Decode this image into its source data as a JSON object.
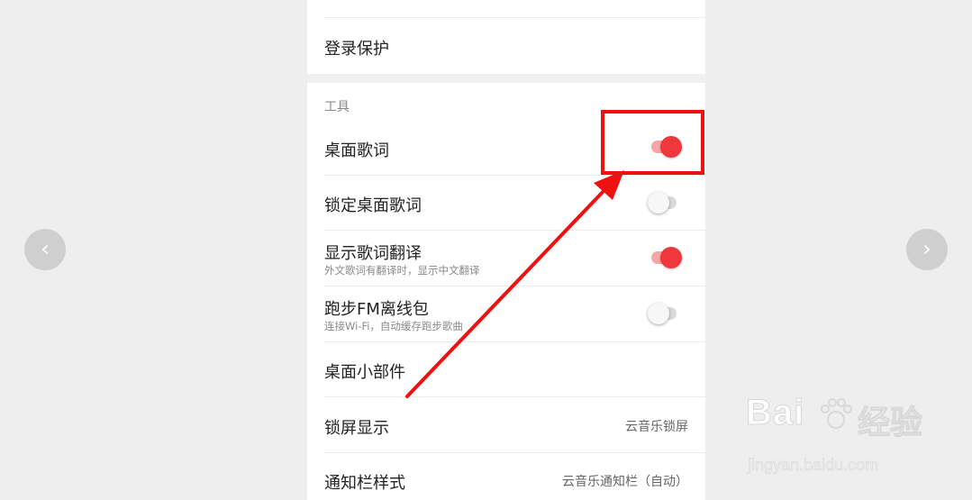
{
  "rows": {
    "login_protect": {
      "title": "登录保护"
    },
    "section_tools": "工具",
    "desktop_lyrics": {
      "title": "桌面歌词",
      "on": true
    },
    "lock_desktop_lyrics": {
      "title": "锁定桌面歌词",
      "on": false
    },
    "show_translation": {
      "title": "显示歌词翻译",
      "subtitle": "外文歌词有翻译时，显示中文翻译",
      "on": true
    },
    "running_fm": {
      "title": "跑步FM离线包",
      "subtitle": "连接Wi-Fi，自动缓存跑步歌曲",
      "on": false
    },
    "desktop_widget": {
      "title": "桌面小部件"
    },
    "lock_screen": {
      "title": "锁屏显示",
      "value": "云音乐锁屏"
    },
    "notification_style": {
      "title": "通知栏样式",
      "value": "云音乐通知栏（自动）"
    }
  },
  "nav": {
    "prev": "‹",
    "next": "›"
  },
  "watermark": {
    "brand": "Bai",
    "brand2": "经验",
    "url": "jingyan.baidu.com"
  },
  "colors": {
    "accent": "#f0383c",
    "annotation": "#ee1111"
  }
}
